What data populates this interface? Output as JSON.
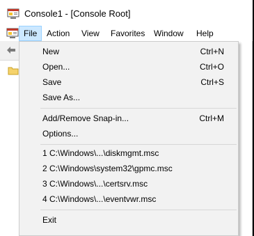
{
  "window": {
    "title": "Console1 - [Console Root]"
  },
  "menubar": {
    "items": [
      "File",
      "Action",
      "View",
      "Favorites",
      "Window",
      "Help"
    ],
    "active": "File"
  },
  "file_menu": {
    "group1": [
      {
        "label": "New",
        "shortcut": "Ctrl+N"
      },
      {
        "label": "Open...",
        "shortcut": "Ctrl+O"
      },
      {
        "label": "Save",
        "shortcut": "Ctrl+S"
      },
      {
        "label": "Save As...",
        "shortcut": ""
      }
    ],
    "group2": [
      {
        "label": "Add/Remove Snap-in...",
        "shortcut": "Ctrl+M"
      },
      {
        "label": "Options...",
        "shortcut": ""
      }
    ],
    "recent": [
      {
        "label": "1 C:\\Windows\\...\\diskmgmt.msc"
      },
      {
        "label": "2 C:\\Windows\\system32\\gpmc.msc"
      },
      {
        "label": "3 C:\\Windows\\...\\certsrv.msc"
      },
      {
        "label": "4 C:\\Windows\\...\\eventvwr.msc"
      }
    ],
    "exit_label": "Exit"
  },
  "colors": {
    "menu_active_bg": "#cce8ff",
    "menu_bg": "#f2f2f2",
    "separator": "#d7d7d7"
  },
  "icons": {
    "app": "mmc-console-icon",
    "back": "back-arrow-icon",
    "tree_root": "folder-icon"
  }
}
